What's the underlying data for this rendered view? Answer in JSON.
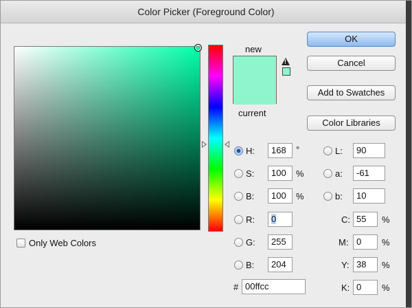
{
  "window": {
    "title": "Color Picker (Foreground Color)"
  },
  "colors": {
    "current_hex": "#8ff5cc",
    "hue_color": "#00ffaa"
  },
  "swatch": {
    "new_label": "new",
    "current_label": "current"
  },
  "buttons": {
    "ok": "OK",
    "cancel": "Cancel",
    "add_to_swatches": "Add to Swatches",
    "color_libraries": "Color Libraries"
  },
  "hsb": {
    "h": {
      "label": "H:",
      "value": "168",
      "unit": "°"
    },
    "s": {
      "label": "S:",
      "value": "100",
      "unit": "%"
    },
    "b": {
      "label": "B:",
      "value": "100",
      "unit": "%"
    }
  },
  "rgb": {
    "r": {
      "label": "R:",
      "value": "0"
    },
    "g": {
      "label": "G:",
      "value": "255"
    },
    "b": {
      "label": "B:",
      "value": "204"
    }
  },
  "lab": {
    "l": {
      "label": "L:",
      "value": "90"
    },
    "a": {
      "label": "a:",
      "value": "-61"
    },
    "b": {
      "label": "b:",
      "value": "10"
    }
  },
  "cmyk": {
    "c": {
      "label": "C:",
      "value": "55",
      "unit": "%"
    },
    "m": {
      "label": "M:",
      "value": "0",
      "unit": "%"
    },
    "y": {
      "label": "Y:",
      "value": "38",
      "unit": "%"
    },
    "k": {
      "label": "K:",
      "value": "0",
      "unit": "%"
    }
  },
  "hex": {
    "label": "#",
    "value": "00ffcc"
  },
  "options": {
    "only_web_colors": "Only Web Colors",
    "only_web_colors_checked": false
  },
  "selected_mode": "H"
}
